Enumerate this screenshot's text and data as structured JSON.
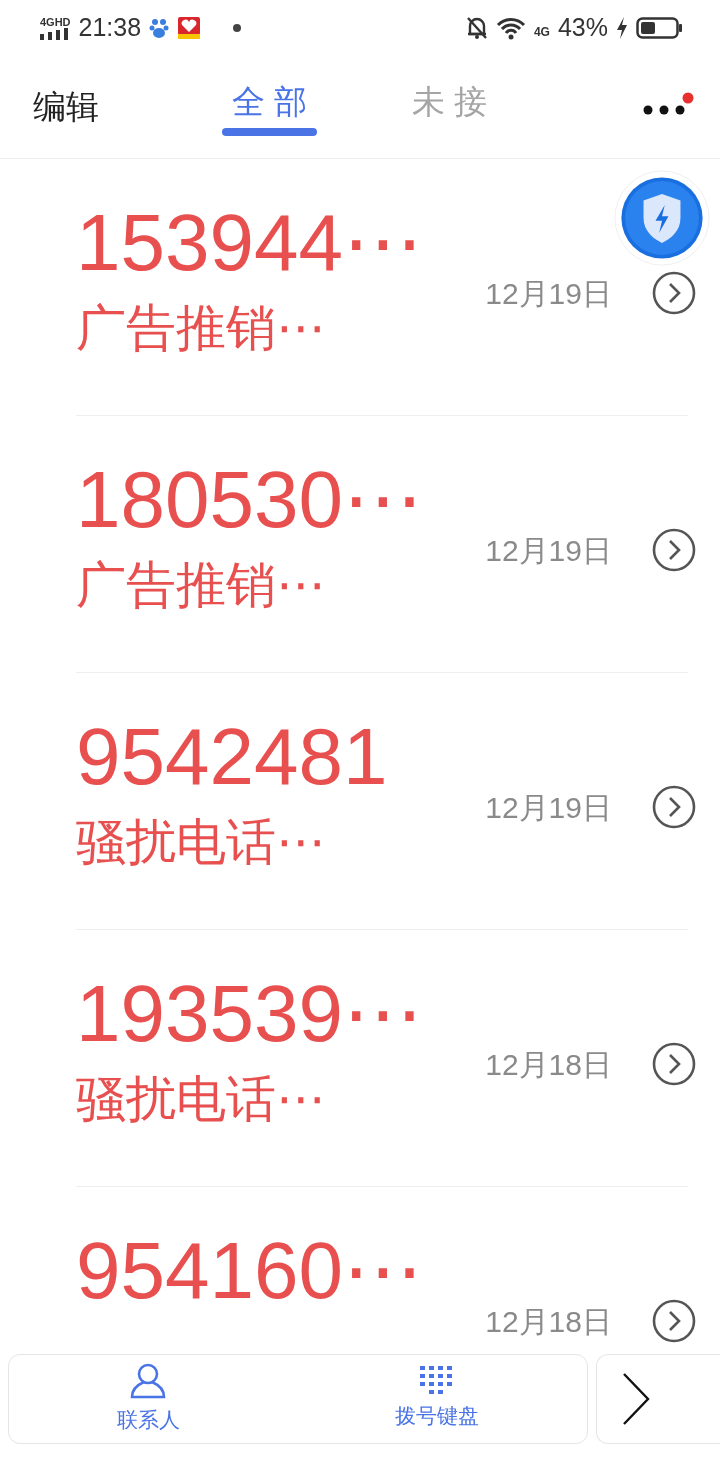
{
  "status_bar": {
    "network": "4GHD",
    "time": "21:38",
    "mobile": "4G",
    "battery": "43%"
  },
  "header": {
    "edit": "编辑",
    "tabs": [
      {
        "label": "全 部",
        "selected": true
      },
      {
        "label": "未 接",
        "selected": false
      }
    ],
    "more_badge": true
  },
  "calls": [
    {
      "number": "153944⋯",
      "label": "广告推销⋯",
      "date": "12月19日"
    },
    {
      "number": "180530⋯",
      "label": "广告推销⋯",
      "date": "12月19日"
    },
    {
      "number": "9542481",
      "label": "骚扰电话⋯",
      "date": "12月19日"
    },
    {
      "number": "193539⋯",
      "label": "骚扰电话⋯",
      "date": "12月18日"
    },
    {
      "number": "954160⋯",
      "date": "12月18日"
    }
  ],
  "bottom_bar": {
    "items": [
      {
        "kind": "contacts",
        "label": "联系人"
      },
      {
        "kind": "dialpad",
        "label": "拨号键盘"
      }
    ]
  }
}
